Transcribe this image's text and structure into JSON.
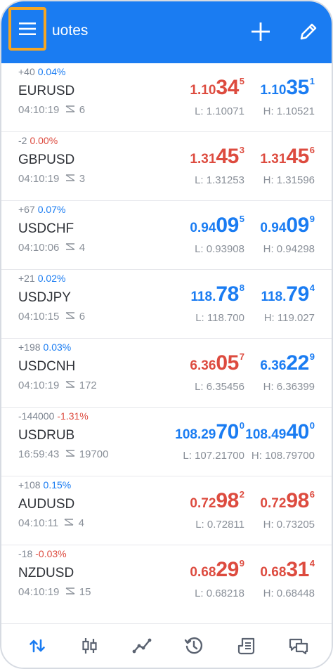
{
  "header": {
    "title": "uotes",
    "menu_icon": "hamburger-menu-icon",
    "add_icon": "plus-icon",
    "edit_icon": "pencil-icon"
  },
  "colors": {
    "accent": "#1a7cf2",
    "down": "#dd4b3f",
    "highlight": "#f5a623"
  },
  "quotes": [
    {
      "change": "+40",
      "pct": "0.04%",
      "pct_color": "blue",
      "symbol": "EURUSD",
      "time": "04:10:19",
      "spread": "6",
      "bid": {
        "main": "1.10",
        "big": "34",
        "sup": "5"
      },
      "ask": {
        "main": "1.10",
        "big": "35",
        "sup": "1"
      },
      "bid_color": "red",
      "ask_color": "blue",
      "low": "L: 1.10071",
      "high": "H: 1.10521"
    },
    {
      "change": "-2",
      "pct": "0.00%",
      "pct_color": "red",
      "symbol": "GBPUSD",
      "time": "04:10:19",
      "spread": "3",
      "bid": {
        "main": "1.31",
        "big": "45",
        "sup": "3"
      },
      "ask": {
        "main": "1.31",
        "big": "45",
        "sup": "6"
      },
      "bid_color": "red",
      "ask_color": "red",
      "low": "L: 1.31253",
      "high": "H: 1.31596"
    },
    {
      "change": "+67",
      "pct": "0.07%",
      "pct_color": "blue",
      "symbol": "USDCHF",
      "time": "04:10:06",
      "spread": "4",
      "bid": {
        "main": "0.94",
        "big": "09",
        "sup": "5"
      },
      "ask": {
        "main": "0.94",
        "big": "09",
        "sup": "9"
      },
      "bid_color": "blue",
      "ask_color": "blue",
      "low": "L: 0.93908",
      "high": "H: 0.94298"
    },
    {
      "change": "+21",
      "pct": "0.02%",
      "pct_color": "blue",
      "symbol": "USDJPY",
      "time": "04:10:15",
      "spread": "6",
      "bid": {
        "main": "118.",
        "big": "78",
        "sup": "8"
      },
      "ask": {
        "main": "118.",
        "big": "79",
        "sup": "4"
      },
      "bid_color": "blue",
      "ask_color": "blue",
      "low": "L: 118.700",
      "high": "H: 119.027"
    },
    {
      "change": "+198",
      "pct": "0.03%",
      "pct_color": "blue",
      "symbol": "USDCNH",
      "time": "04:10:19",
      "spread": "172",
      "bid": {
        "main": "6.36",
        "big": "05",
        "sup": "7"
      },
      "ask": {
        "main": "6.36",
        "big": "22",
        "sup": "9"
      },
      "bid_color": "red",
      "ask_color": "blue",
      "low": "L: 6.35456",
      "high": "H: 6.36399"
    },
    {
      "change": "-144000",
      "pct": "-1.31%",
      "pct_color": "red",
      "symbol": "USDRUB",
      "time": "16:59:43",
      "spread": "19700",
      "bid": {
        "main": "108.29",
        "big": "70",
        "sup": "0"
      },
      "ask": {
        "main": "108.49",
        "big": "40",
        "sup": "0"
      },
      "bid_color": "blue",
      "ask_color": "blue",
      "low": "L: 107.21700",
      "high": "H: 108.79700"
    },
    {
      "change": "+108",
      "pct": "0.15%",
      "pct_color": "blue",
      "symbol": "AUDUSD",
      "time": "04:10:11",
      "spread": "4",
      "bid": {
        "main": "0.72",
        "big": "98",
        "sup": "2"
      },
      "ask": {
        "main": "0.72",
        "big": "98",
        "sup": "6"
      },
      "bid_color": "red",
      "ask_color": "red",
      "low": "L: 0.72811",
      "high": "H: 0.73205"
    },
    {
      "change": "-18",
      "pct": "-0.03%",
      "pct_color": "red",
      "symbol": "NZDUSD",
      "time": "04:10:19",
      "spread": "15",
      "bid": {
        "main": "0.68",
        "big": "29",
        "sup": "9"
      },
      "ask": {
        "main": "0.68",
        "big": "31",
        "sup": "4"
      },
      "bid_color": "red",
      "ask_color": "red",
      "low": "L: 0.68218",
      "high": "H: 0.68448"
    }
  ],
  "tabs": [
    {
      "icon": "quotes-arrows-icon",
      "active": true
    },
    {
      "icon": "chart-candles-icon",
      "active": false
    },
    {
      "icon": "trade-line-icon",
      "active": false
    },
    {
      "icon": "history-clock-icon",
      "active": false
    },
    {
      "icon": "journal-icon",
      "active": false
    },
    {
      "icon": "messages-icon",
      "active": false
    }
  ]
}
